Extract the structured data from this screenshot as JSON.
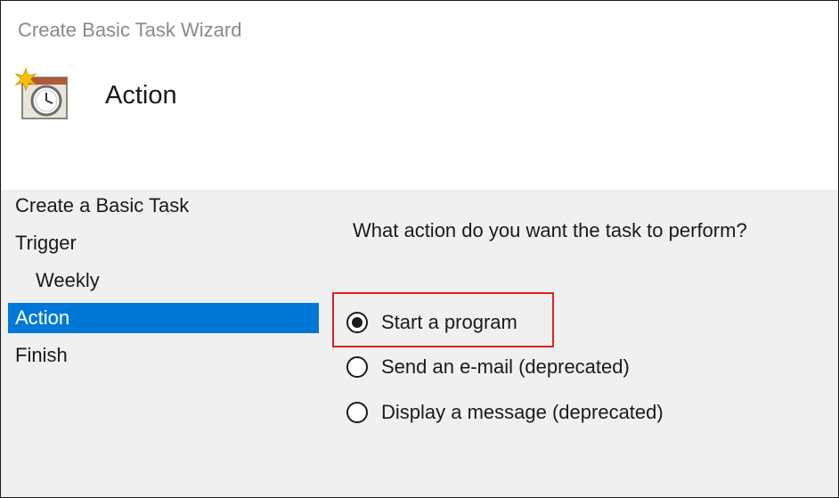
{
  "window": {
    "title": "Create Basic Task Wizard"
  },
  "header": {
    "title": "Action",
    "icon": "scheduled-task-clock-icon"
  },
  "nav": {
    "items": [
      {
        "label": "Create a Basic Task",
        "selected": false
      },
      {
        "label": "Trigger",
        "selected": false
      },
      {
        "label": "Weekly",
        "selected": false,
        "indent": true
      },
      {
        "label": "Action",
        "selected": true
      },
      {
        "label": "Finish",
        "selected": false
      }
    ]
  },
  "content": {
    "question": "What action do you want the task to perform?",
    "options": [
      {
        "label": "Start a program",
        "checked": true
      },
      {
        "label": "Send an e-mail (deprecated)",
        "checked": false
      },
      {
        "label": "Display a message (deprecated)",
        "checked": false
      }
    ]
  },
  "colors": {
    "selection": "#0078d7",
    "highlight_border": "#e02020",
    "panel_background": "#f0f0f0",
    "title_text": "#8a8a8a"
  }
}
